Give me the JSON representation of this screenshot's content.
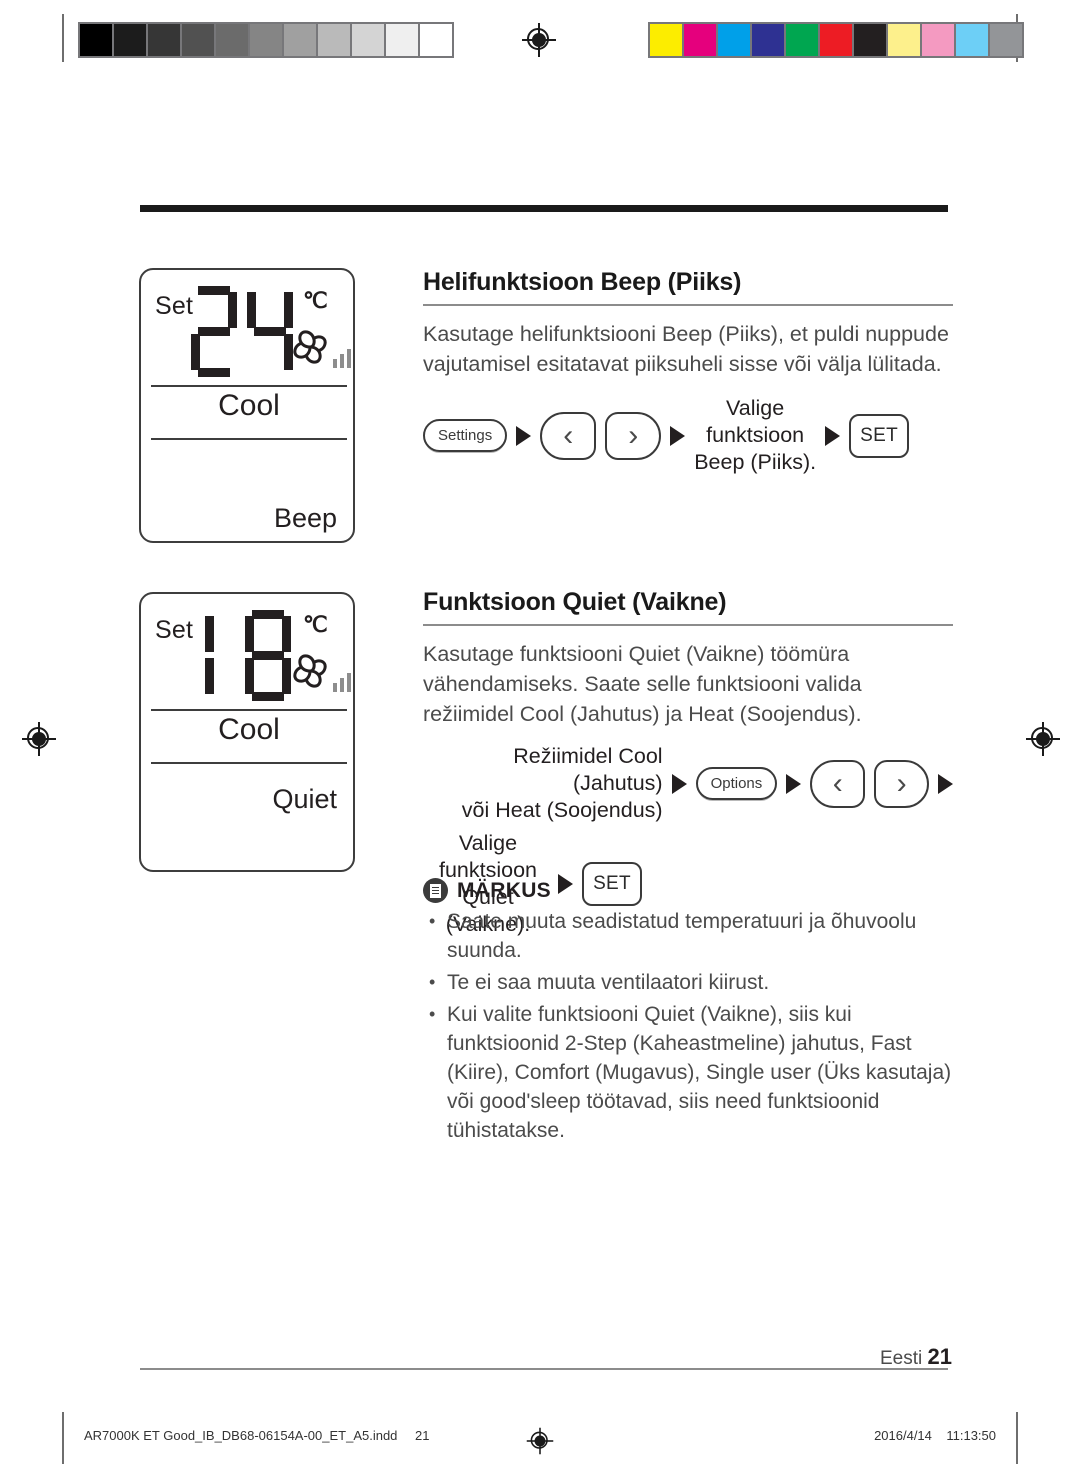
{
  "print_marks": {
    "gray_swatches": [
      "#000000",
      "#1c1c1c",
      "#363636",
      "#515151",
      "#6b6b6b",
      "#858585",
      "#a0a0a0",
      "#bababa",
      "#d4d4d4",
      "#efefef",
      "#ffffff"
    ],
    "color_swatches": [
      "#fced00",
      "#e5007d",
      "#00a0e9",
      "#2e3192",
      "#00a650",
      "#ed1c24",
      "#231f20",
      "#fdf08c",
      "#f49ac1",
      "#6dcff6",
      "#939598"
    ],
    "registration_icon": "registration-target-icon"
  },
  "displays": [
    {
      "set_label": "Set",
      "temperature": "24",
      "unit": "℃",
      "mode": "Cool",
      "status": "Beep",
      "fan_icon": "fan-pinwheel-icon",
      "fan_speed_bars": 3
    },
    {
      "set_label": "Set",
      "temperature": "18",
      "unit": "℃",
      "mode": "Cool",
      "status": "Quiet",
      "fan_icon": "fan-pinwheel-icon",
      "fan_speed_bars": 3
    }
  ],
  "sections": [
    {
      "title": "Helifunktsioon Beep (Piiks)",
      "body": "Kasutage helifunktsiooni Beep (Piiks), et puldi nuppude vajutamisel esitatavat piiksuheli sisse või välja lülitada.",
      "flow": {
        "settings_button": "Settings",
        "left_arrow": "‹",
        "right_arrow": "›",
        "select_label": "Valige\nfunktsioon\nBeep (Piiks).",
        "set_button": "SET"
      }
    },
    {
      "title": "Funktsioon Quiet (Vaikne)",
      "body": "Kasutage funktsiooni Quiet (Vaikne) töömüra vähendamiseks. Saate selle funktsiooni valida režiimidel Cool (Jahutus) ja Heat (Soojendus).",
      "flow": {
        "mode_label": "Režiimidel Cool (Jahutus)\nvõi Heat (Soojendus)",
        "options_button": "Options",
        "left_arrow": "‹",
        "right_arrow": "›",
        "select_label": "Valige\nfunktsioon\nQuiet\n(Vaikne).",
        "set_button": "SET"
      }
    }
  ],
  "note": {
    "icon": "note-document-icon",
    "title": "MÄRKUS",
    "items": [
      "Saate muuta seadistatud temperatuuri ja õhuvoolu suunda.",
      "Te ei saa muuta ventilaatori kiirust.",
      "Kui valite funktsiooni Quiet (Vaikne), siis kui funktsioonid 2-Step (Kaheastmeline) jahutus, Fast (Kiire), Comfort (Mugavus), Single user (Üks kasutaja) või good'sleep töötavad, siis need funktsioonid tühistatakse."
    ]
  },
  "footer": {
    "language": "Eesti",
    "page_number": "21"
  },
  "print_footer": {
    "filename": "AR7000K ET Good_IB_DB68-06154A-00_ET_A5.indd",
    "page": "21",
    "date": "2016/4/14",
    "time": "11:13:50",
    "registration_icon": "registration-target-icon"
  }
}
